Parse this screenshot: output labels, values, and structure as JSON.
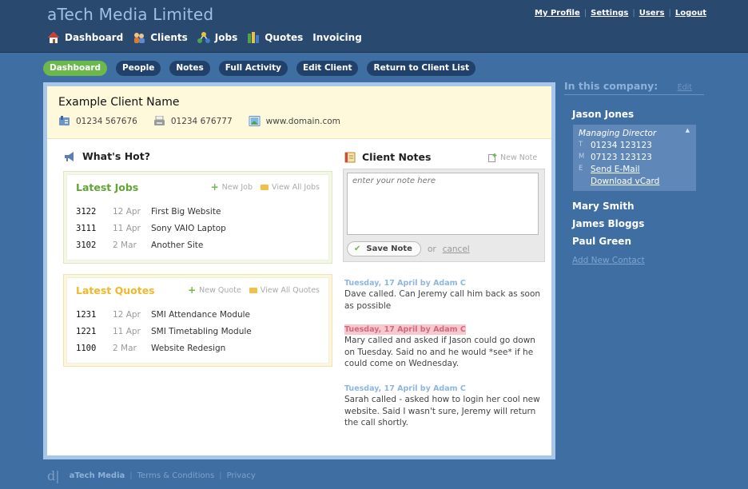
{
  "header": {
    "brand": "aTech Media Limited",
    "nav": [
      {
        "label": "Dashboard",
        "icon": "house-icon"
      },
      {
        "label": "Clients",
        "icon": "people-icon"
      },
      {
        "label": "Jobs",
        "icon": "network-icon"
      },
      {
        "label": "Quotes",
        "icon": "books-icon"
      },
      {
        "label": "Invoicing",
        "icon": ""
      }
    ],
    "user_links": [
      "My Profile",
      "Settings",
      "Users",
      "Logout"
    ]
  },
  "subnav": {
    "items": [
      "Dashboard",
      "People",
      "Notes",
      "Full Activity",
      "Edit Client",
      "Return to Client List"
    ],
    "active": "Dashboard"
  },
  "client": {
    "name": "Example Client Name",
    "phone": "01234 567676",
    "fax": "01234 676777",
    "website": "www.domain.com"
  },
  "whats_hot": {
    "title": "What's Hot?",
    "jobs": {
      "title": "Latest Jobs",
      "new_label": "New Job",
      "view_all_label": "View All Jobs",
      "rows": [
        {
          "num": "3122",
          "date": "12 Apr",
          "desc": "First Big Website"
        },
        {
          "num": "3111",
          "date": "11 Apr",
          "desc": "Sony VAIO Laptop"
        },
        {
          "num": "3102",
          "date": "2 Mar",
          "desc": "Another Site"
        }
      ]
    },
    "quotes": {
      "title": "Latest Quotes",
      "new_label": "New Quote",
      "view_all_label": "View All Quotes",
      "rows": [
        {
          "num": "1231",
          "date": "12 Apr",
          "desc": "SMI Attendance Module"
        },
        {
          "num": "1221",
          "date": "11 Apr",
          "desc": "SMI Timetabling Module"
        },
        {
          "num": "1100",
          "date": "2 Mar",
          "desc": "Website Redesign"
        }
      ]
    }
  },
  "notes": {
    "title": "Client Notes",
    "new_label": "New Note",
    "placeholder": "enter your note here",
    "save_label": "Save Note",
    "or_label": "or",
    "cancel_label": "cancel",
    "items": [
      {
        "meta": "Tuesday, 17 April by Adam C",
        "text": "Dave called. Can Jeremy call him back as soon as possible",
        "highlight": false
      },
      {
        "meta": "Tuesday, 17 April by Adam C",
        "text": "Mary called and asked if Jason could go down on Tuesday. Said no and he would *see* if he could come on Wednesday.",
        "highlight": true
      },
      {
        "meta": "Tuesday, 17 April by Adam C",
        "text": "Sarah called - asked how to login her cool new website. Said I wasn't sure, Jeremy will return the call shortly.",
        "highlight": false
      }
    ]
  },
  "sidebar": {
    "title": "In this company:",
    "edit_label": "Edit",
    "contacts": [
      {
        "name": "Jason Jones",
        "role": "Managing Director",
        "t_key": "T",
        "phone": "01234 123123",
        "m_key": "M",
        "mobile": "07123 123123",
        "e_key": "E",
        "email_label": "Send E-Mail",
        "vcard_label": "Download vCard"
      },
      {
        "name": "Mary Smith"
      },
      {
        "name": "James Bloggs"
      },
      {
        "name": "Paul Green"
      }
    ],
    "add_label": "Add New Contact"
  },
  "footer": {
    "logo": "d|",
    "company": "aTech Media",
    "links": [
      "Terms & Conditions",
      "Privacy"
    ]
  },
  "colors": {
    "page_bg": "#3f6ea3",
    "header_bg": "#294a6e",
    "accent_green": "#6cb84a",
    "quotes_yellow": "#f0b82a"
  }
}
